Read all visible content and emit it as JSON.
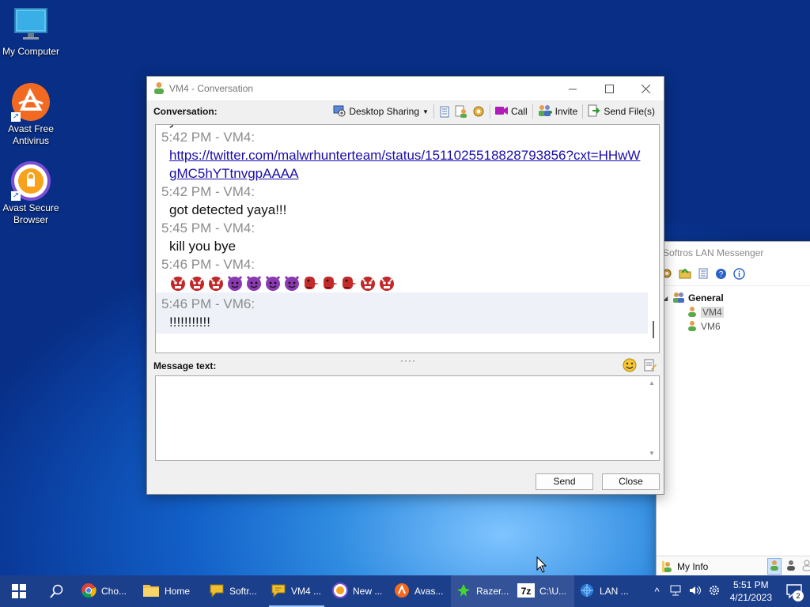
{
  "desktop": {
    "icons": [
      {
        "label": "My Computer",
        "icon": "monitor-icon"
      },
      {
        "label": "Avast Free Antivirus",
        "icon": "avast-icon"
      },
      {
        "label": "Avast Secure Browser",
        "icon": "avast-browser-icon"
      }
    ]
  },
  "conversation_window": {
    "title": "VM4 - Conversation",
    "toolbar": {
      "label": "Conversation:",
      "desktop_sharing": "Desktop Sharing",
      "call": "Call",
      "invite": "Invite",
      "send_files": "Send File(s)"
    },
    "partial_text": "you",
    "messages": [
      {
        "meta": "5:42 PM - VM4:",
        "link": "https://twitter.com/malwrhunterteam/status/1511025518828793856?cxt=HHwWgMC5hYTtnvgpAAAA"
      },
      {
        "meta": "5:42 PM - VM4:",
        "text": "got detected yaya!!!"
      },
      {
        "meta": "5:45 PM - VM4:",
        "text": "kill you bye"
      },
      {
        "meta": "5:46 PM - VM4:",
        "emojis": [
          "oni",
          "oni",
          "oni",
          "imp",
          "imp",
          "imp",
          "imp",
          "long-nose-goblin",
          "long-nose-goblin",
          "long-nose-goblin",
          "oni",
          "oni"
        ]
      },
      {
        "meta": "5:46 PM - VM6:",
        "text": "!!!!!!!!!!!"
      }
    ],
    "message_label": "Message text:",
    "message_value": "",
    "send": "Send",
    "close": "Close"
  },
  "lan_window": {
    "title": "Softros LAN Messenger",
    "group": "General",
    "users": [
      "VM4",
      "VM6"
    ],
    "my_info": "My Info"
  },
  "taskbar": {
    "items": [
      {
        "label": "Cho...",
        "icon": "chrome-icon"
      },
      {
        "label": "Home",
        "icon": "folder-icon"
      },
      {
        "label": "Softr...",
        "icon": "softros-icon"
      },
      {
        "label": "VM4 ...",
        "icon": "softros-chat-icon"
      },
      {
        "label": "New ...",
        "icon": "avast-browser-icon"
      },
      {
        "label": "Avas...",
        "icon": "avast-icon"
      },
      {
        "label": "Razer...",
        "icon": "razer-icon"
      },
      {
        "label": "C:\\U...",
        "icon": "7zip-icon"
      },
      {
        "label": "LAN ...",
        "icon": "lan-icon"
      }
    ],
    "time": "5:51 PM",
    "date": "4/21/2023",
    "notifications": "2"
  }
}
